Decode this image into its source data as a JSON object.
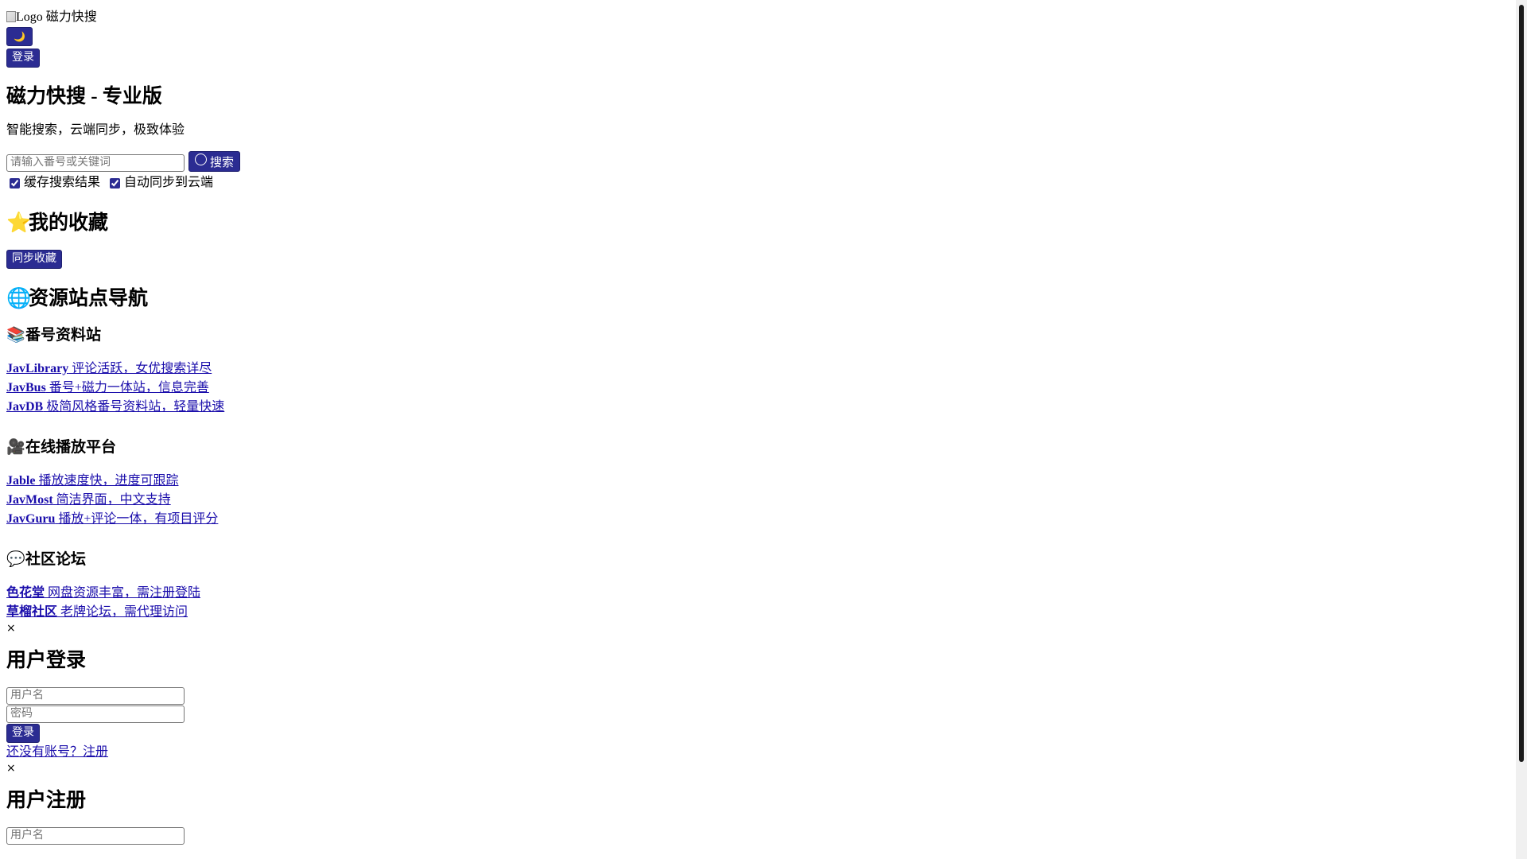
{
  "header": {
    "logo_alt": "Logo",
    "site_name": "磁力快搜",
    "theme_toggle_icon": "moon-icon",
    "theme_toggle_glyph": "🌙",
    "login_label": "登录"
  },
  "hero": {
    "title": "磁力快搜 - 专业版",
    "subtitle": "智能搜索，云端同步，极致体验"
  },
  "search": {
    "placeholder": "请输入番号或关键词",
    "button_label": "搜索",
    "button_icon": "search-icon",
    "options": [
      {
        "label": "缓存搜索结果",
        "checked": true
      },
      {
        "label": "自动同步到云端",
        "checked": true
      }
    ]
  },
  "favorites": {
    "icon": "star-icon",
    "icon_glyph": "⭐",
    "title": "我的收藏",
    "sync_label": "同步收藏"
  },
  "nav": {
    "icon": "globe-icon",
    "icon_glyph": "🌐",
    "title": "资源站点导航",
    "groups": [
      {
        "icon": "books-icon",
        "icon_glyph": "📚",
        "title": "番号资料站",
        "links": [
          {
            "name": "JavLibrary",
            "desc": " 评论活跃，女优搜索详尽"
          },
          {
            "name": "JavBus",
            "desc": " 番号+磁力一体站，信息完善"
          },
          {
            "name": "JavDB",
            "desc": " 极简风格番号资料站，轻量快速"
          }
        ]
      },
      {
        "icon": "video-camera-icon",
        "icon_glyph": "🎥",
        "title": "在线播放平台",
        "links": [
          {
            "name": "Jable",
            "desc": " 播放速度快，进度可跟踪"
          },
          {
            "name": "JavMost",
            "desc": " 简洁界面，中文支持"
          },
          {
            "name": "JavGuru",
            "desc": " 播放+评论一体，有项目评分"
          }
        ]
      },
      {
        "icon": "speech-bubble-icon",
        "icon_glyph": "💬",
        "title": "社区论坛",
        "links": [
          {
            "name": "色花堂",
            "desc": " 网盘资源丰富，需注册登陆"
          },
          {
            "name": "草榴社区",
            "desc": " 老牌论坛，需代理访问"
          }
        ]
      }
    ]
  },
  "login_modal": {
    "close": "×",
    "title": "用户登录",
    "username_placeholder": "用户名",
    "password_placeholder": "密码",
    "submit_label": "登录",
    "register_link": "还没有账号？注册"
  },
  "register_modal": {
    "close": "×",
    "title": "用户注册",
    "username_placeholder": "用户名"
  }
}
